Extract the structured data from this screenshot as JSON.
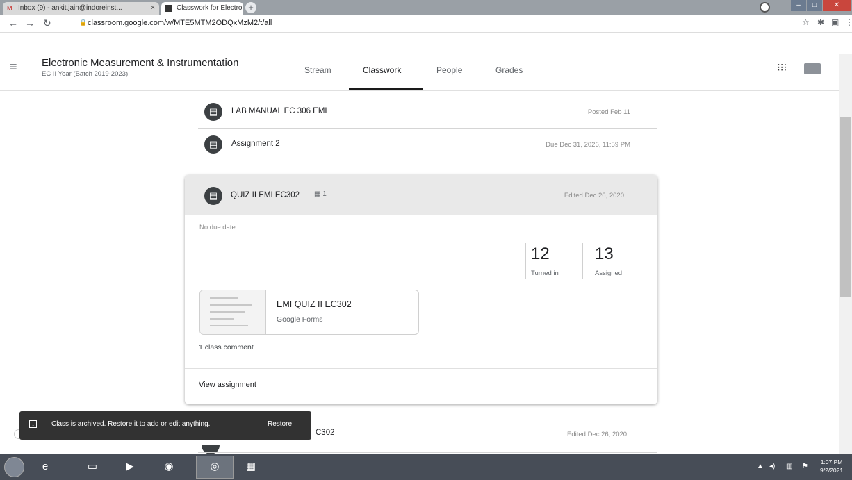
{
  "browser": {
    "tabs": [
      {
        "label": "Inbox (9) - ankit.jain@indoreinst...",
        "icon": "gmail-icon"
      },
      {
        "label": "Classwork for Electronic Measure",
        "icon": "classroom-icon"
      }
    ],
    "url": "classroom.google.com/w/MTE5MTM2ODQxMzM2/t/all",
    "new_tab_glyph": "+",
    "tab_close_glyph": "×"
  },
  "class_header": {
    "title": "Electronic Measurement & Instrumentation",
    "subtitle": "EC II Year (Batch 2019-2023)",
    "tabs": [
      {
        "label": "Stream",
        "active": false
      },
      {
        "label": "Classwork",
        "active": true
      },
      {
        "label": "People",
        "active": false
      },
      {
        "label": "Grades",
        "active": false
      }
    ]
  },
  "classwork": {
    "items": [
      {
        "title": "LAB MANUAL EC 306 EMI",
        "meta": "Posted Feb 11",
        "icon": "material-icon"
      },
      {
        "title": "Assignment 2",
        "meta": "Due Dec 31, 2026, 11:59 PM",
        "icon": "assignment-icon"
      }
    ],
    "expanded": {
      "title": "QUIZ II EMI EC302",
      "comment_count": "1",
      "meta": "Edited Dec 26, 2020",
      "due": "No due date",
      "turned_in": {
        "value": "12",
        "label": "Turned in"
      },
      "assigned": {
        "value": "13",
        "label": "Assigned"
      },
      "attachment": {
        "title": "EMI QUIZ II EC302",
        "subtitle": "Google Forms"
      },
      "class_comment": "1 class comment",
      "view_link": "View assignment"
    },
    "partial_item": {
      "title_visible": "C302",
      "meta": "Edited Dec 26, 2020"
    }
  },
  "snackbar": {
    "message": "Class is archived. Restore it to add or edit anything.",
    "action": "Restore"
  },
  "taskbar": {
    "time": "1:07 PM",
    "date": "9/2/2021"
  }
}
